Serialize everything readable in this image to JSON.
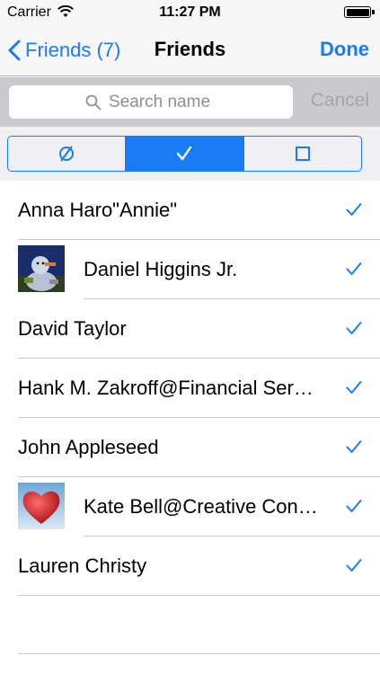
{
  "status_bar": {
    "carrier": "Carrier",
    "time": "11:27 PM",
    "wifi_icon": "wifi-icon",
    "battery_icon": "battery-full-icon"
  },
  "nav_bar": {
    "back_label": "Friends (7)",
    "back_icon": "chevron-left-icon",
    "title": "Friends",
    "done_label": "Done"
  },
  "search": {
    "placeholder": "Search name",
    "value": "",
    "cancel_label": "Cancel",
    "icon": "magnifier-icon"
  },
  "segments": [
    {
      "icon": "empty-set-icon",
      "selected": false
    },
    {
      "icon": "checkmark-icon",
      "selected": true
    },
    {
      "icon": "square-icon",
      "selected": false
    }
  ],
  "friends": [
    {
      "name": "Anna Haro\"Annie\"",
      "avatar": null,
      "checked": true
    },
    {
      "name": "Daniel Higgins Jr.",
      "avatar": "snowman-photo",
      "checked": true
    },
    {
      "name": "David Taylor",
      "avatar": null,
      "checked": true
    },
    {
      "name": "Hank M. Zakroff@Financial Ser…",
      "avatar": null,
      "checked": true
    },
    {
      "name": "John Appleseed",
      "avatar": null,
      "checked": true
    },
    {
      "name": "Kate Bell@Creative Con…",
      "avatar": "heart-photo",
      "checked": true
    },
    {
      "name": "Lauren Christy",
      "avatar": null,
      "checked": true
    }
  ],
  "colors": {
    "accent": "#1a7cf4",
    "search_bar_bg": "#c9c9ce",
    "separator": "#c8c7cc"
  }
}
